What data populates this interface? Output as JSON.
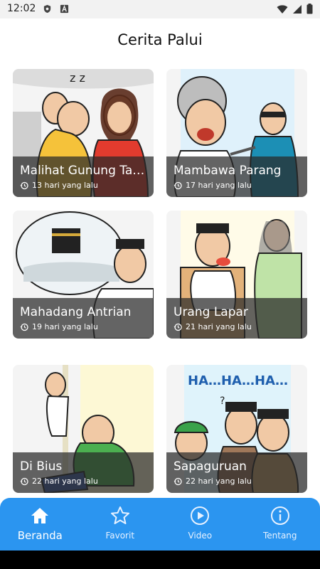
{
  "status_bar": {
    "time": "12:02",
    "left_icons": [
      "shield-icon",
      "font-a-icon"
    ],
    "right_icons": [
      "wifi-icon",
      "signal-icon",
      "battery-icon"
    ]
  },
  "header": {
    "title": "Cerita Palui"
  },
  "stories": [
    {
      "title": "Malihat Gunung Tahura",
      "time_ago": "13 hari yang lalu",
      "illustration": "bus-sleeping-passenger"
    },
    {
      "title": "Mambawa Parang",
      "time_ago": "17 hari yang lalu",
      "illustration": "man-with-machete"
    },
    {
      "title": "Mahadang Antrian",
      "time_ago": "19 hari yang lalu",
      "illustration": "man-dreaming-kaaba"
    },
    {
      "title": "Urang Lapar",
      "time_ago": "21 hari yang lalu",
      "illustration": "man-at-window-woman"
    },
    {
      "title": "Di Bius",
      "time_ago": "22 hari yang lalu",
      "illustration": "man-sitting-dizzy"
    },
    {
      "title": "Sapaguruan",
      "time_ago": "22 hari yang lalu",
      "illustration": "laughing-group"
    }
  ],
  "bottom_nav": {
    "items": [
      {
        "label": "Beranda",
        "icon": "home-icon",
        "active": true
      },
      {
        "label": "Favorit",
        "icon": "star-icon",
        "active": false
      },
      {
        "label": "Video",
        "icon": "play-circle-icon",
        "active": false
      },
      {
        "label": "Tentang",
        "icon": "info-icon",
        "active": false
      }
    ]
  },
  "colors": {
    "nav_bg": "#2b95f0",
    "overlay": "#282828",
    "accent_white": "#ffffff"
  }
}
